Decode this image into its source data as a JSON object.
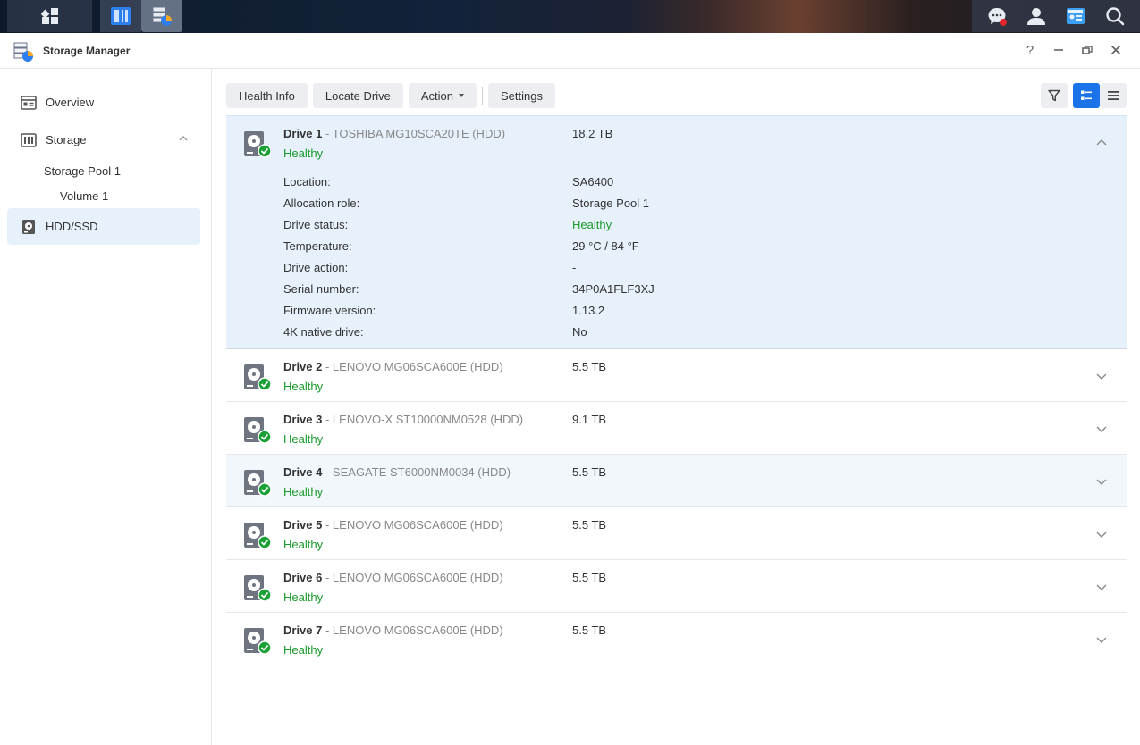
{
  "window": {
    "title": "Storage Manager"
  },
  "window_controls": {
    "help": "?"
  },
  "sidebar": {
    "items": [
      {
        "label": "Overview",
        "icon": "overview-icon"
      },
      {
        "label": "Storage",
        "icon": "storage-icon"
      },
      {
        "label": "Storage Pool 1"
      },
      {
        "label": "Volume 1"
      },
      {
        "label": "HDD/SSD",
        "icon": "hdd-icon"
      }
    ]
  },
  "toolbar": {
    "health_info": "Health Info",
    "locate_drive": "Locate Drive",
    "action": "Action",
    "settings": "Settings"
  },
  "colors": {
    "accent": "#1a73e8",
    "healthy": "#199a2a",
    "selected_bg": "#e6f1fc"
  },
  "drives": [
    {
      "name": "Drive 1",
      "model": " - TOSHIBA MG10SCA20TE (HDD)",
      "status": "Healthy",
      "size": "18.2 TB"
    },
    {
      "name": "Drive 2",
      "model": " - LENOVO MG06SCA600E (HDD)",
      "status": "Healthy",
      "size": "5.5 TB"
    },
    {
      "name": "Drive 3",
      "model": " - LENOVO-X ST10000NM0528 (HDD)",
      "status": "Healthy",
      "size": "9.1 TB"
    },
    {
      "name": "Drive 4",
      "model": " - SEAGATE ST6000NM0034 (HDD)",
      "status": "Healthy",
      "size": "5.5 TB"
    },
    {
      "name": "Drive 5",
      "model": " - LENOVO MG06SCA600E (HDD)",
      "status": "Healthy",
      "size": "5.5 TB"
    },
    {
      "name": "Drive 6",
      "model": " - LENOVO MG06SCA600E (HDD)",
      "status": "Healthy",
      "size": "5.5 TB"
    },
    {
      "name": "Drive 7",
      "model": " - LENOVO MG06SCA600E (HDD)",
      "status": "Healthy",
      "size": "5.5 TB"
    }
  ],
  "drive1_details": [
    {
      "label": "Location:",
      "value": "SA6400"
    },
    {
      "label": "Allocation role:",
      "value": "Storage Pool 1"
    },
    {
      "label": "Drive status:",
      "value": "Healthy"
    },
    {
      "label": "Temperature:",
      "value": "29 °C / 84 °F"
    },
    {
      "label": "Drive action:",
      "value": "-"
    },
    {
      "label": "Serial number:",
      "value": "34P0A1FLF3XJ"
    },
    {
      "label": "Firmware version:",
      "value": "1.13.2"
    },
    {
      "label": "4K native drive:",
      "value": "No"
    }
  ]
}
